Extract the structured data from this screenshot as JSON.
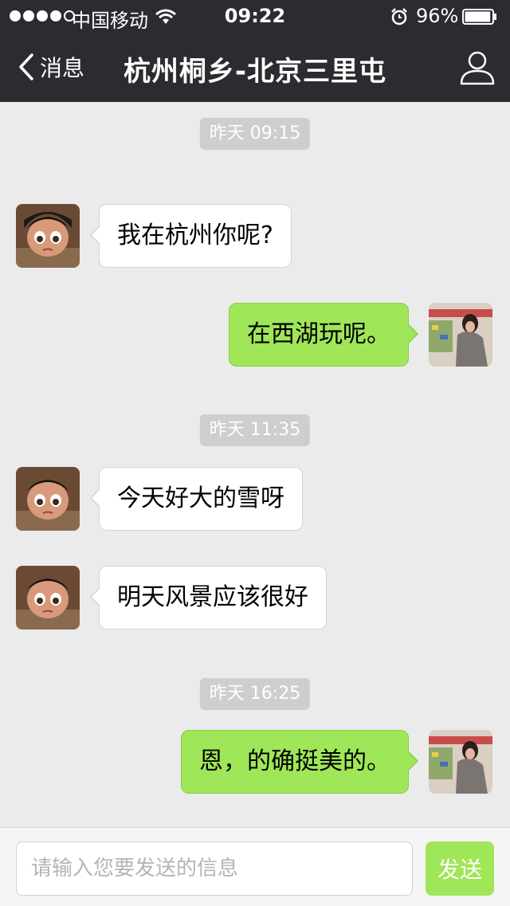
{
  "status_bar": {
    "carrier": "中国移动",
    "time": "09:22",
    "battery": "96%",
    "battery_level": 0.96,
    "signal_bars": 4,
    "signal_max": 5
  },
  "nav": {
    "back_label": "消息",
    "title": "杭州桐乡-北京三里屯",
    "back_icon": "chevron-left-icon",
    "profile_icon": "person-icon"
  },
  "chat": {
    "timestamps": [
      "昨天 09:15",
      "昨天 11:35",
      "昨天 16:25"
    ],
    "messages": [
      {
        "sender": "other",
        "text": "我在杭州你呢?"
      },
      {
        "sender": "me",
        "text": "在西湖玩呢。"
      },
      {
        "sender": "other",
        "text": "今天好大的雪呀"
      },
      {
        "sender": "other",
        "text": "明天风景应该很好"
      },
      {
        "sender": "me",
        "text": "恩，的确挺美的。"
      }
    ]
  },
  "input": {
    "placeholder": "请输入您要发送的信息",
    "value": "",
    "send_label": "发送"
  },
  "colors": {
    "nav_bg": "#2b2c30",
    "chat_bg": "#ebebeb",
    "outgoing_bubble": "#9fe658",
    "incoming_bubble": "#ffffff",
    "time_pill": "#cecece",
    "send_button": "#9fe658"
  }
}
